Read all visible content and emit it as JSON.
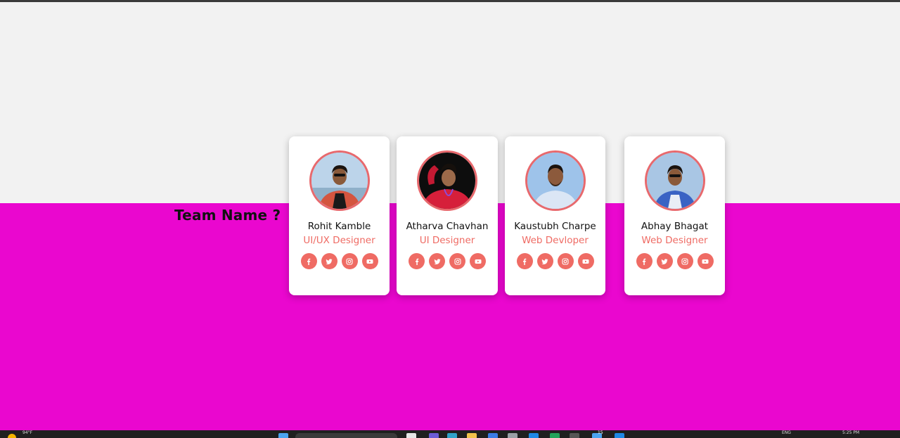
{
  "heading": "Team Name ?",
  "members": [
    {
      "name": "Rohit Kamble",
      "role": "UI/UX Designer",
      "photo": "person-photo"
    },
    {
      "name": "Atharva Chavhan",
      "role": "UI Designer",
      "photo": "person-photo"
    },
    {
      "name": "Kaustubh Charpe",
      "role": "Web Devloper",
      "photo": "person-photo"
    },
    {
      "name": "Abhay Bhagat",
      "role": "Web Designer",
      "photo": "person-photo"
    }
  ],
  "social_icons": [
    "facebook-icon",
    "twitter-icon",
    "instagram-icon",
    "youtube-icon"
  ],
  "colors": {
    "accent": "#ef6b64",
    "lower_background": "#ea07cf",
    "upper_background": "#f2f2f2",
    "card": "#ffffff"
  },
  "taskbar": {
    "temperature": "94°F",
    "language": "ENG",
    "time": "5:25 PM",
    "badge": "15"
  }
}
